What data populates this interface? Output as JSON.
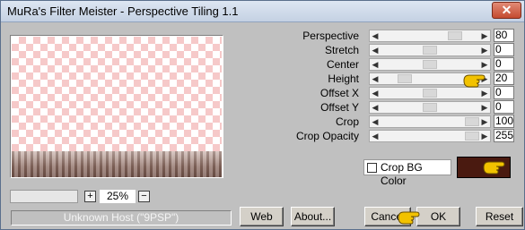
{
  "window": {
    "title": "MuRa's Filter Meister - Perspective Tiling 1.1"
  },
  "params": [
    {
      "label": "Perspective",
      "value": "80",
      "level": 80
    },
    {
      "label": "Stretch",
      "value": "0",
      "level": 50
    },
    {
      "label": "Center",
      "value": "0",
      "level": 50
    },
    {
      "label": "Height",
      "value": "20",
      "level": 20
    },
    {
      "label": "Offset X",
      "value": "0",
      "level": 50
    },
    {
      "label": "Offset Y",
      "value": "0",
      "level": 50
    },
    {
      "label": "Crop",
      "value": "100",
      "level": 100
    },
    {
      "label": "Crop Opacity",
      "value": "255",
      "level": 100
    }
  ],
  "crop_bg": {
    "label": "Crop BG Color",
    "color": "#4a1a10",
    "checked": false
  },
  "zoom": {
    "value": "25%",
    "plus": "+",
    "minus": "−"
  },
  "host": {
    "text": "Unknown Host (\"9PSP\")"
  },
  "buttons": {
    "web": "Web",
    "about": "About...",
    "cancel": "Cancel",
    "ok": "OK",
    "reset": "Reset"
  },
  "colors": {
    "checker_pink": "#f6c9c9",
    "titlebar": "#c4d1e3",
    "close": "#c44a2f",
    "pointer_hand": "#f2c200"
  },
  "icons": {
    "close": "close-icon",
    "pointer": "pointing-hand-icon"
  }
}
